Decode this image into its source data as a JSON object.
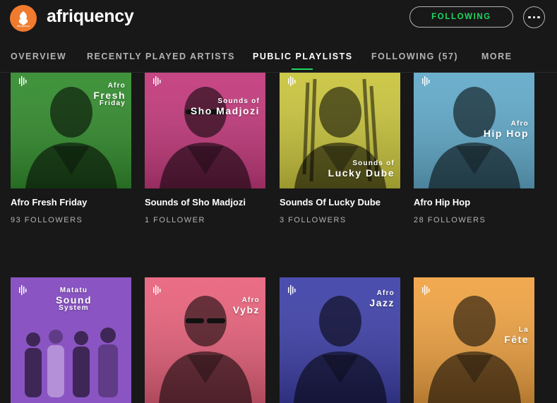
{
  "header": {
    "avatar_text": "afriquency",
    "title": "afriquency",
    "follow_button": "FOLLOWING",
    "more_icon": "ellipsis-icon"
  },
  "tabs": [
    {
      "label": "OVERVIEW",
      "active": false
    },
    {
      "label": "RECENTLY PLAYED ARTISTS",
      "active": false
    },
    {
      "label": "PUBLIC PLAYLISTS",
      "active": true
    },
    {
      "label": "FOLLOWING (57)",
      "active": false
    },
    {
      "label": "MORE",
      "active": false
    }
  ],
  "colors": {
    "accent": "#1ed760",
    "background": "#181818",
    "brand_orange": "#f07b2f"
  },
  "playlists": [
    {
      "cover_small": "Afro",
      "cover_big": "Fresh",
      "cover_small2": "Friday",
      "name": "Afro Fresh Friday",
      "followers": "93 FOLLOWERS",
      "tint": "#2f8a2a"
    },
    {
      "cover_small": "Sounds of",
      "cover_big": "Sho Madjozi",
      "name": "Sounds of Sho Madjozi",
      "followers": "1 FOLLOWER",
      "tint": "#c2367a"
    },
    {
      "cover_small": "Sounds of",
      "cover_big": "Lucky Dube",
      "name": "Sounds Of Lucky Dube",
      "followers": "3 FOLLOWERS",
      "tint": "#c9c43a"
    },
    {
      "cover_small": "Afro",
      "cover_big": "Hip Hop",
      "name": "Afro Hip Hop",
      "followers": "28 FOLLOWERS",
      "tint": "#5fa9c9"
    },
    {
      "cover_small": "Matatu",
      "cover_big": "Sound",
      "cover_small2": "System",
      "tint": "#8a55c2"
    },
    {
      "cover_small": "Afro",
      "cover_big": "Vybz",
      "tint": "#e8607a"
    },
    {
      "cover_small": "Afro",
      "cover_big": "Jazz",
      "tint": "#3c3ea8"
    },
    {
      "cover_small": "La",
      "cover_big": "Fête",
      "tint": "#f0a240"
    }
  ]
}
